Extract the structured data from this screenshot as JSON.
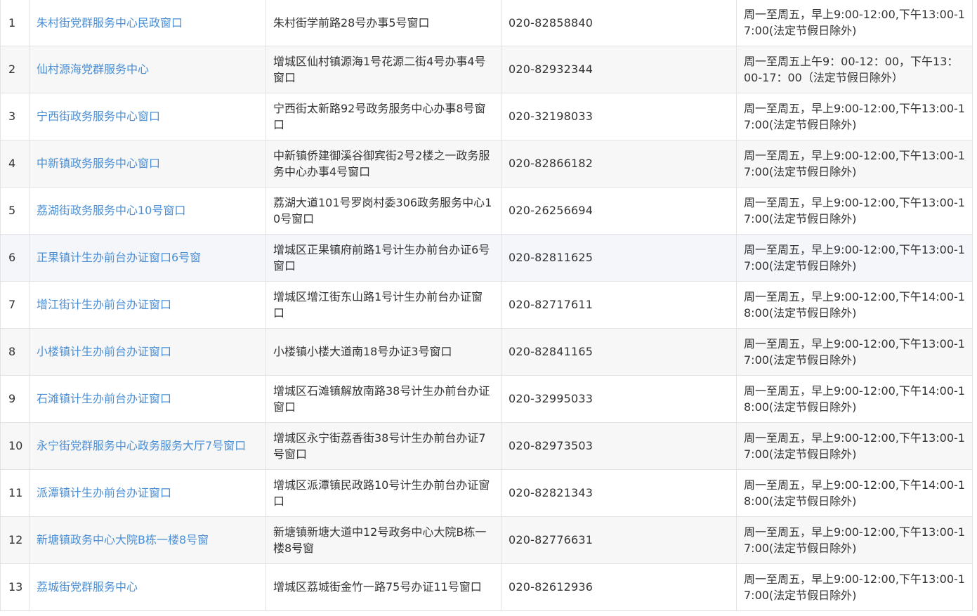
{
  "rows": [
    {
      "no": "1",
      "name": "朱村街党群服务中心民政窗口",
      "address": "朱村街学前路28号办事5号窗口",
      "phone": "020-82858840",
      "hours": "周一至周五，早上9:00-12:00,下午13:00-17:00(法定节假日除外)"
    },
    {
      "no": "2",
      "name": "仙村源海党群服务中心",
      "address": "增城区仙村镇源海1号花源二街4号办事4号窗口",
      "phone": "020-82932344",
      "hours": "周一至周五上午9：00-12：00，下午13：00-17：00（法定节假日除外）"
    },
    {
      "no": "3",
      "name": "宁西街政务服务中心窗口",
      "address": "宁西街太新路92号政务服务中心办事8号窗口",
      "phone": "020-32198033",
      "hours": "周一至周五，早上9:00-12:00,下午13:00-17:00(法定节假日除外)"
    },
    {
      "no": "4",
      "name": "中新镇政务服务中心窗口",
      "address": "中新镇侨建御溪谷御宾街2号2楼之一政务服务中心办事4号窗口",
      "phone": "020-82866182",
      "hours": "周一至周五，早上9:00-12:00,下午13:00-17:00(法定节假日除外)"
    },
    {
      "no": "5",
      "name": "荔湖街政务服务中心10号窗口",
      "address": "荔湖大道101号罗岗村委306政务服务中心10号窗口",
      "phone": "020-26256694",
      "hours": "周一至周五，早上9:00-12:00,下午13:00-17:00(法定节假日除外)"
    },
    {
      "no": "6",
      "name": "正果镇计生办前台办证窗口6号窗",
      "address": "增城区正果镇府前路1号计生办前台办证6号窗口",
      "phone": "020-82811625",
      "hours": "周一至周五，早上9:00-12:00,下午13:00-17:00(法定节假日除外)"
    },
    {
      "no": "7",
      "name": "增江街计生办前台办证窗口",
      "address": "增城区增江街东山路1号计生办前台办证窗口",
      "phone": "020-82717611",
      "hours": "周一至周五，早上9:00-12:00,下午14:00-18:00(法定节假日除外)"
    },
    {
      "no": "8",
      "name": "小楼镇计生办前台办证窗口",
      "address": "小楼镇小楼大道南18号办证3号窗口",
      "phone": "020-82841165",
      "hours": "周一至周五，早上9:00-12:00,下午13:00-17:00(法定节假日除外)"
    },
    {
      "no": "9",
      "name": "石滩镇计生办前台办证窗口",
      "address": "增城区石滩镇解放南路38号计生办前台办证窗口",
      "phone": "020-32995033",
      "hours": "周一至周五，早上9:00-12:00,下午14:00-18:00(法定节假日除外)"
    },
    {
      "no": "10",
      "name": "永宁街党群服务中心政务服务大厅7号窗口",
      "address": "增城区永宁街荔香街38号计生办前台办证7号窗口",
      "phone": "020-82973503",
      "hours": "周一至周五，早上9:00-12:00,下午13:00-17:00(法定节假日除外)"
    },
    {
      "no": "11",
      "name": "派潭镇计生办前台办证窗口",
      "address": "增城区派潭镇民政路10号计生办前台办证窗口",
      "phone": "020-82821343",
      "hours": "周一至周五，早上9:00-12:00,下午14:00-18:00(法定节假日除外)"
    },
    {
      "no": "12",
      "name": "新塘镇政务中心大院B栋一楼8号窗",
      "address": "新塘镇新塘大道中12号政务中心大院B栋一楼8号窗",
      "phone": "020-82776631",
      "hours": "周一至周五，早上9:00-12:00,下午13:00-17:00(法定节假日除外)"
    },
    {
      "no": "13",
      "name": "荔城街党群服务中心",
      "address": "增城区荔城街金竹一路75号办证11号窗口",
      "phone": "020-82612936",
      "hours": "周一至周五，早上9:00-12:00,下午13:00-17:00(法定节假日除外)"
    }
  ],
  "colors": {
    "link": "#4a8fd6",
    "text": "#333333",
    "border": "#e3e3e3",
    "stripe": "#f7f7f7",
    "highlight_row": "#f4f6fa"
  }
}
